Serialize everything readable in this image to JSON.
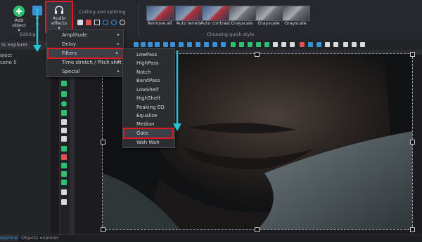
{
  "ribbon": {
    "add_object": "Add\nobject",
    "add_object_arrow": "▾",
    "video_effects_partial": "V\ne",
    "editing_group": "Editing",
    "audio_effects": "Audio\neffects",
    "audio_effects_arrow": "▾",
    "cutting_group": "Cutting and splitting",
    "quick_style_group": "Choosing quick style",
    "styles": [
      "Remove all",
      "Auto levels",
      "Auto contrast",
      "Grayscale",
      "Grayscale",
      "Grayscale"
    ]
  },
  "left_panel": {
    "tab_label": "ts explorer",
    "pin": "✕",
    "items": [
      "oject",
      "cene 0"
    ]
  },
  "bottom_tabs": [
    "explorer",
    "Objects explorer"
  ],
  "audio_menu": {
    "items": [
      "Amplitude",
      "Delay",
      "Filters",
      "Time stretch / Pitch shift",
      "Special"
    ],
    "arrow": "▸"
  },
  "filters_menu": {
    "items": [
      "LowPass",
      "HighPass",
      "Notch",
      "BandPass",
      "LowShelf",
      "HighShelf",
      "Peaking EQ",
      "Equalize",
      "Median",
      "Gate",
      "Wah Wah"
    ]
  },
  "colors": {
    "highlight": "#e01b24",
    "annotation_arrow": "#1ec8d8",
    "accent_green": "#2fbf71",
    "accent_blue": "#3b8fd6"
  }
}
